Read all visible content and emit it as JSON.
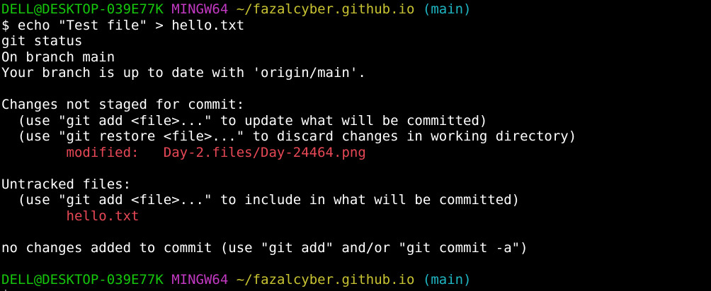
{
  "colors": {
    "background": "#000000",
    "text": "#ffffff",
    "user_host": "#16c60c",
    "shell": "#c239c2",
    "path": "#c8c332",
    "branch": "#1fb6c3",
    "changed_file": "#e74856"
  },
  "prompt": {
    "user_host": "DELL@DESKTOP-039E77K",
    "shell": "MINGW64",
    "path": "~/fazalcyber.github.io",
    "branch": "(main)",
    "symbol": "$"
  },
  "command": "echo \"Test file\" > hello.txt",
  "output": {
    "line1": "git status",
    "line2": "On branch main",
    "line3": "Your branch is up to date with 'origin/main'.",
    "changes_header": "Changes not staged for commit:",
    "hint_add": "  (use \"git add <file>...\" to update what will be committed)",
    "hint_restore": "  (use \"git restore <file>...\" to discard changes in working directory)",
    "modified_label": "        modified:   ",
    "modified_file": "Day-2.files/Day-24464.png",
    "untracked_header": "Untracked files:",
    "hint_include": "  (use \"git add <file>...\" to include in what will be committed)",
    "untracked_indent": "        ",
    "untracked_file": "hello.txt",
    "summary": "no changes added to commit (use \"git add\" and/or \"git commit -a\")"
  }
}
